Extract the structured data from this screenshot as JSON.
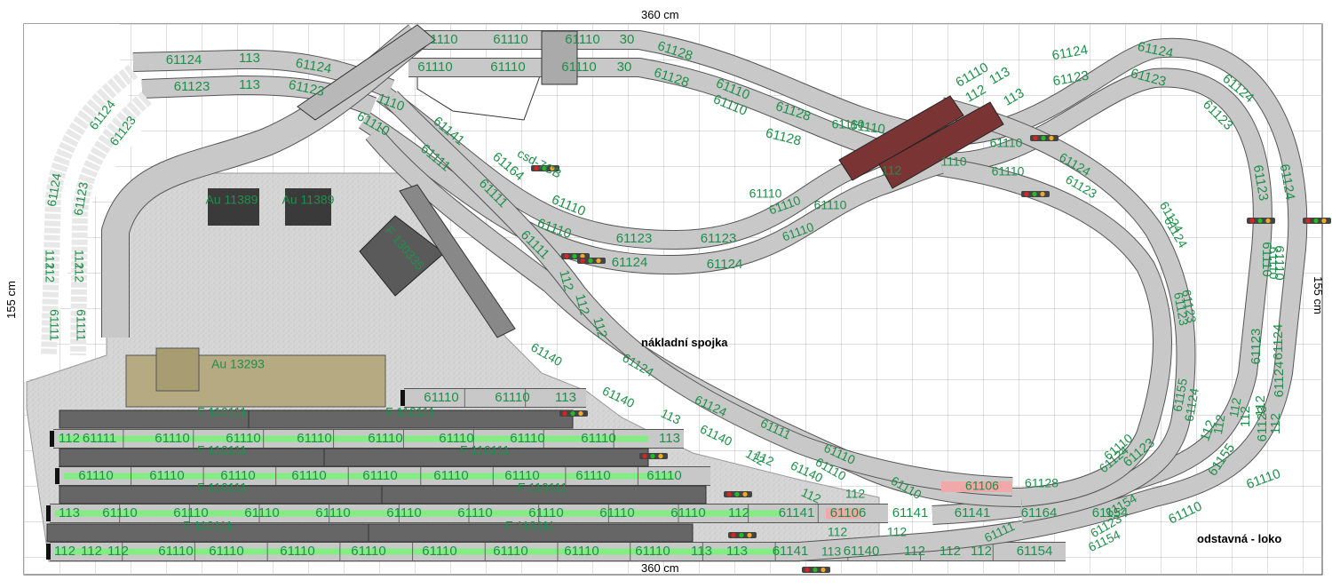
{
  "dimensions": {
    "top": "360 cm",
    "bottom": "360 cm",
    "left": "155 cm",
    "right": "155 cm"
  },
  "notes": {
    "freight_link": "nákladní spojka",
    "loco_siding": "odstavná - loko"
  },
  "colors": {
    "track": "#c8c8c8",
    "label": "#1f8f4a",
    "bridge": "#7a3434",
    "highlight": "#7cf07c",
    "platform": "#666666",
    "yard": "#d8d8d8",
    "grid": "#c0c0c0",
    "building": "#b5aa82"
  },
  "buildings": [
    {
      "label": "Au 11389"
    },
    {
      "label": "Au 11389"
    },
    {
      "label": "F 130335"
    },
    {
      "label": "Au 13293"
    }
  ],
  "platforms": [
    "F 110111",
    "F 110111",
    "F 110111",
    "F 110111",
    "F 110111",
    "F 110111",
    "F 110111",
    "F 110111"
  ],
  "signal_label": "csd-7CB",
  "yard_rows": [
    [
      "112",
      "61111",
      "61110",
      "61110",
      "61110",
      "61110",
      "61110",
      "61110",
      "61110",
      "113"
    ],
    [
      "61110",
      "61110",
      "61110",
      "61110",
      "61110",
      "61110",
      "61110",
      "61110",
      "61110"
    ],
    [
      "113",
      "61110",
      "61110",
      "61110",
      "61110",
      "61110",
      "61110",
      "61110",
      "61110",
      "61110",
      "112",
      "61141",
      "61106",
      "61141",
      "61141",
      "61164",
      "61154"
    ],
    [
      "112",
      "112",
      "112",
      "61110",
      "61110",
      "61110",
      "61110",
      "61110",
      "61110",
      "61110",
      "61110",
      "113",
      "113",
      "61141",
      "61140",
      "112",
      "112",
      "112",
      "61154"
    ]
  ],
  "upper_row": [
    "61110",
    "61110",
    "113"
  ],
  "left_top": [
    "61124",
    "113",
    "61124",
    "61123",
    "113",
    "61123"
  ],
  "left_curve": [
    "61124",
    "61123",
    "61124",
    "61123",
    "112",
    "112",
    "61111",
    "112",
    "112",
    "61111"
  ],
  "top_straights": [
    "1110",
    "61110",
    "61110",
    "30",
    "61110",
    "61110",
    "61110",
    "30"
  ],
  "main_loop_outer": [
    "61128",
    "61110",
    "61128",
    "61110",
    "112",
    "113",
    "61124",
    "61124",
    "61124",
    "61124",
    "61110",
    "61124",
    "61124",
    "112",
    "112",
    "61155",
    "61110"
  ],
  "main_loop_inner": [
    "61128",
    "61110",
    "61128",
    "61110",
    "113",
    "61123",
    "61123",
    "61123",
    "61123",
    "61110",
    "61123",
    "61123",
    "112",
    "112",
    "61123",
    "61110"
  ],
  "crossing_tracks": [
    "1110",
    "61110",
    "61141",
    "61111",
    "61164",
    "61111",
    "61110",
    "61110",
    "61123",
    "61123",
    "61111",
    "61124",
    "61124",
    "112",
    "112",
    "112"
  ],
  "misc_labels": [
    "61110",
    "61110",
    "61124",
    "61124",
    "61123",
    "61124",
    "61123",
    "61123",
    "61110",
    "61155",
    "61124",
    "61124",
    "61106",
    "61128",
    "61154",
    "61110",
    "61110",
    "61110",
    "112",
    "1110",
    "61140",
    "113",
    "61140",
    "112",
    "61140",
    "112",
    "61140",
    "61124",
    "61124",
    "61111",
    "61110",
    "61110",
    "61123",
    "61154",
    "61111",
    "112",
    "112",
    "112",
    "112",
    "112",
    "112",
    "113",
    "61110",
    "61110",
    "61110",
    "61110"
  ]
}
